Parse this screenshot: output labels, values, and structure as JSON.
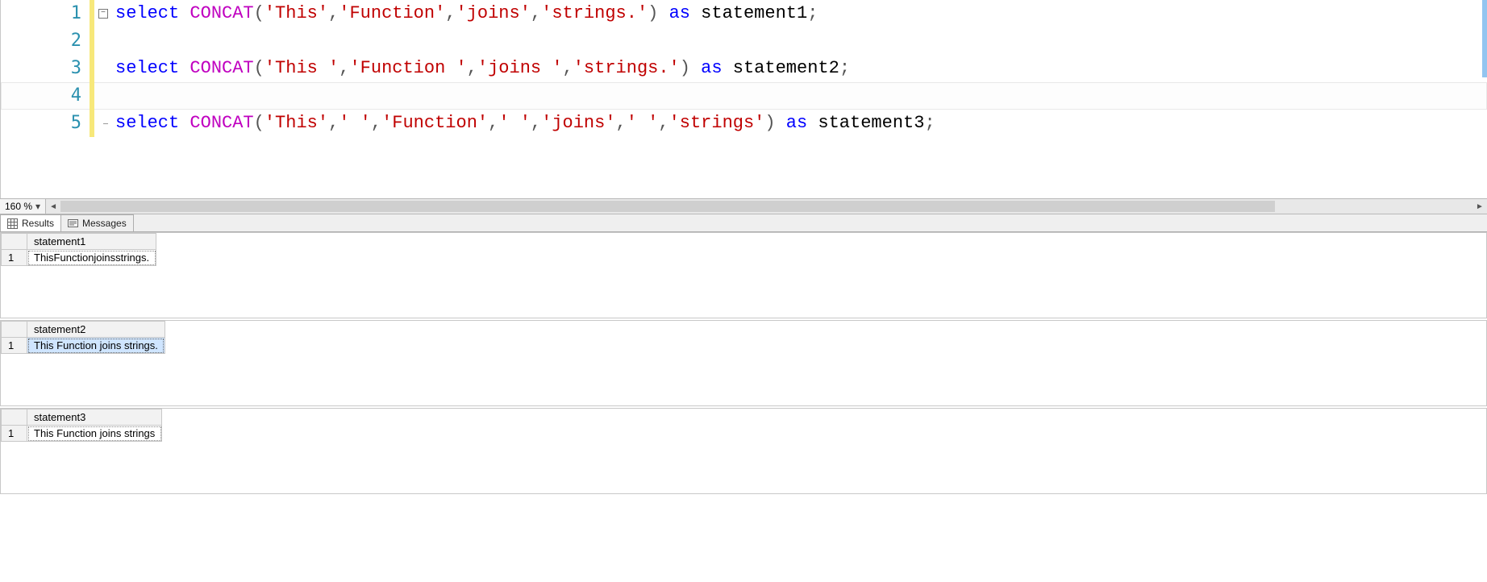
{
  "editor": {
    "lines": [
      {
        "no": 1,
        "tokens": [
          {
            "t": "kw",
            "v": "select"
          },
          {
            "t": "plain",
            "v": " "
          },
          {
            "t": "fn",
            "v": "CONCAT"
          },
          {
            "t": "op",
            "v": "("
          },
          {
            "t": "str",
            "v": "'This'"
          },
          {
            "t": "op",
            "v": ","
          },
          {
            "t": "str",
            "v": "'Function'"
          },
          {
            "t": "op",
            "v": ","
          },
          {
            "t": "str",
            "v": "'joins'"
          },
          {
            "t": "op",
            "v": ","
          },
          {
            "t": "str",
            "v": "'strings.'"
          },
          {
            "t": "op",
            "v": ")"
          },
          {
            "t": "plain",
            "v": " "
          },
          {
            "t": "kw",
            "v": "as"
          },
          {
            "t": "plain",
            "v": " "
          },
          {
            "t": "plain",
            "v": "statement1"
          },
          {
            "t": "op",
            "v": ";"
          }
        ]
      },
      {
        "no": 2,
        "tokens": []
      },
      {
        "no": 3,
        "tokens": [
          {
            "t": "kw",
            "v": "select"
          },
          {
            "t": "plain",
            "v": " "
          },
          {
            "t": "fn",
            "v": "CONCAT"
          },
          {
            "t": "op",
            "v": "("
          },
          {
            "t": "str",
            "v": "'This '"
          },
          {
            "t": "op",
            "v": ","
          },
          {
            "t": "str",
            "v": "'Function '"
          },
          {
            "t": "op",
            "v": ","
          },
          {
            "t": "str",
            "v": "'joins '"
          },
          {
            "t": "op",
            "v": ","
          },
          {
            "t": "str",
            "v": "'strings.'"
          },
          {
            "t": "op",
            "v": ")"
          },
          {
            "t": "plain",
            "v": " "
          },
          {
            "t": "kw",
            "v": "as"
          },
          {
            "t": "plain",
            "v": " "
          },
          {
            "t": "plain",
            "v": "statement2"
          },
          {
            "t": "op",
            "v": ";"
          }
        ]
      },
      {
        "no": 4,
        "tokens": []
      },
      {
        "no": 5,
        "tokens": [
          {
            "t": "kw",
            "v": "select"
          },
          {
            "t": "plain",
            "v": " "
          },
          {
            "t": "fn",
            "v": "CONCAT"
          },
          {
            "t": "op",
            "v": "("
          },
          {
            "t": "str",
            "v": "'This'"
          },
          {
            "t": "op",
            "v": ","
          },
          {
            "t": "str",
            "v": "' '"
          },
          {
            "t": "op",
            "v": ","
          },
          {
            "t": "str",
            "v": "'Function'"
          },
          {
            "t": "op",
            "v": ","
          },
          {
            "t": "str",
            "v": "' '"
          },
          {
            "t": "op",
            "v": ","
          },
          {
            "t": "str",
            "v": "'joins'"
          },
          {
            "t": "op",
            "v": ","
          },
          {
            "t": "str",
            "v": "' '"
          },
          {
            "t": "op",
            "v": ","
          },
          {
            "t": "str",
            "v": "'strings'"
          },
          {
            "t": "op",
            "v": ")"
          },
          {
            "t": "plain",
            "v": " "
          },
          {
            "t": "kw",
            "v": "as"
          },
          {
            "t": "plain",
            "v": " "
          },
          {
            "t": "plain",
            "v": "statement3"
          },
          {
            "t": "op",
            "v": ";"
          }
        ]
      }
    ],
    "current_line_index": 3,
    "collapse_glyph": "−"
  },
  "zoom": {
    "label": "160 %"
  },
  "tabs": {
    "results": "Results",
    "messages": "Messages"
  },
  "results": [
    {
      "header": "statement1",
      "rownum": "1",
      "value": "ThisFunctionjoinsstrings.",
      "selected": false,
      "dotted": true
    },
    {
      "header": "statement2",
      "rownum": "1",
      "value": "This Function joins strings.",
      "selected": true,
      "dotted": false
    },
    {
      "header": "statement3",
      "rownum": "1",
      "value": "This Function joins strings",
      "selected": false,
      "dotted": true
    }
  ]
}
